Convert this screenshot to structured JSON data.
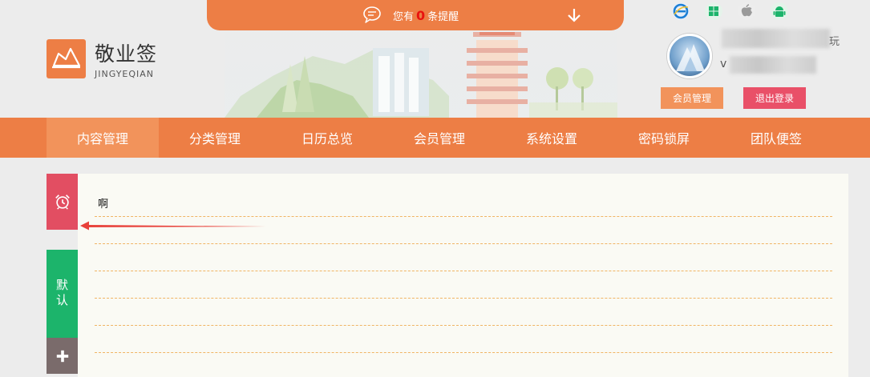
{
  "reminder": {
    "prefix": "您有",
    "count": "0",
    "suffix": "条提醒"
  },
  "brand": {
    "title": "敬业签",
    "subtitle": "JINGYEQIAN"
  },
  "platforms": [
    "ie-icon",
    "windows-icon",
    "apple-icon",
    "android-icon"
  ],
  "user": {
    "name_tail": "玩",
    "line2_lead": "v"
  },
  "buttons": {
    "member": "会员管理",
    "logout": "退出登录"
  },
  "nav": {
    "items": [
      {
        "label": "内容管理",
        "active": true
      },
      {
        "label": "分类管理"
      },
      {
        "label": "日历总览"
      },
      {
        "label": "会员管理"
      },
      {
        "label": "系统设置"
      },
      {
        "label": "密码锁屏"
      },
      {
        "label": "团队便签"
      }
    ]
  },
  "sidebar": {
    "default_label": "默认",
    "add_label": "+"
  },
  "note": {
    "text": "啊"
  },
  "colors": {
    "accent": "#ed7e45",
    "accent_light": "#f2935b",
    "danger": "#e95068",
    "green": "#1cb46b",
    "tab_red": "#e24e62",
    "gray_brown": "#7a6b6b"
  }
}
